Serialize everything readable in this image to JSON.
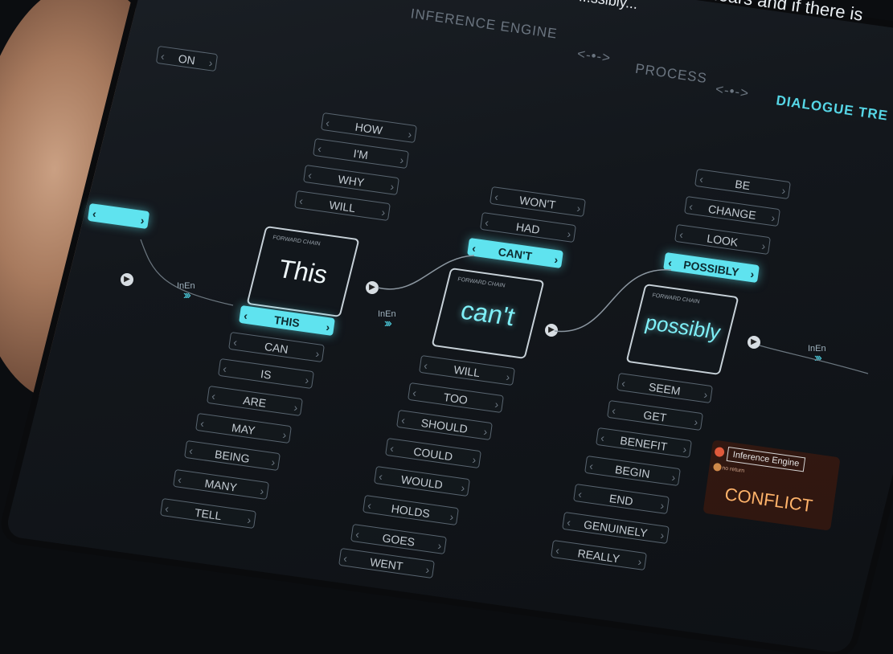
{
  "header": {
    "line1": "...ears and if there is",
    "line2": "...ssibly..."
  },
  "breadcrumb": {
    "items": [
      "INFERENCE ENGINE",
      "PROCESS",
      "DIALOGUE TRE"
    ],
    "separator": "<-•->"
  },
  "left_column": {
    "items": [
      "ON"
    ]
  },
  "col1": {
    "above": [
      "HOW",
      "I'M",
      "WHY",
      "WILL"
    ],
    "selected": "THIS",
    "below": [
      "CAN",
      "IS",
      "ARE",
      "MAY",
      "BEING",
      "MANY",
      "TELL"
    ]
  },
  "col2": {
    "above": [
      "WON'T",
      "HAD"
    ],
    "selected": "CAN'T",
    "below": [
      "WILL",
      "TOO",
      "SHOULD",
      "COULD",
      "WOULD",
      "HOLDS",
      "GOES",
      "WENT"
    ]
  },
  "col3": {
    "above": [
      "BE",
      "CHANGE",
      "LOOK"
    ],
    "selected": "POSSIBLY",
    "below": [
      "SEEM",
      "GET",
      "BENEFIT",
      "BEGIN",
      "END",
      "GENUINELY",
      "REALLY"
    ]
  },
  "nodes": [
    {
      "chain_label": "FORWARD CHAIN",
      "word": "This"
    },
    {
      "chain_label": "FORWARD CHAIN",
      "word": "can't"
    },
    {
      "chain_label": "FORWARD CHAIN",
      "word": "possibly"
    }
  ],
  "connector_label": "InEn",
  "popup": {
    "title": "Inference Engine",
    "subtitle": "no return",
    "status": "CONFLICT"
  },
  "colors": {
    "accent": "#5fe3ef",
    "background": "#12171c",
    "conflict": "#ffb36a"
  }
}
